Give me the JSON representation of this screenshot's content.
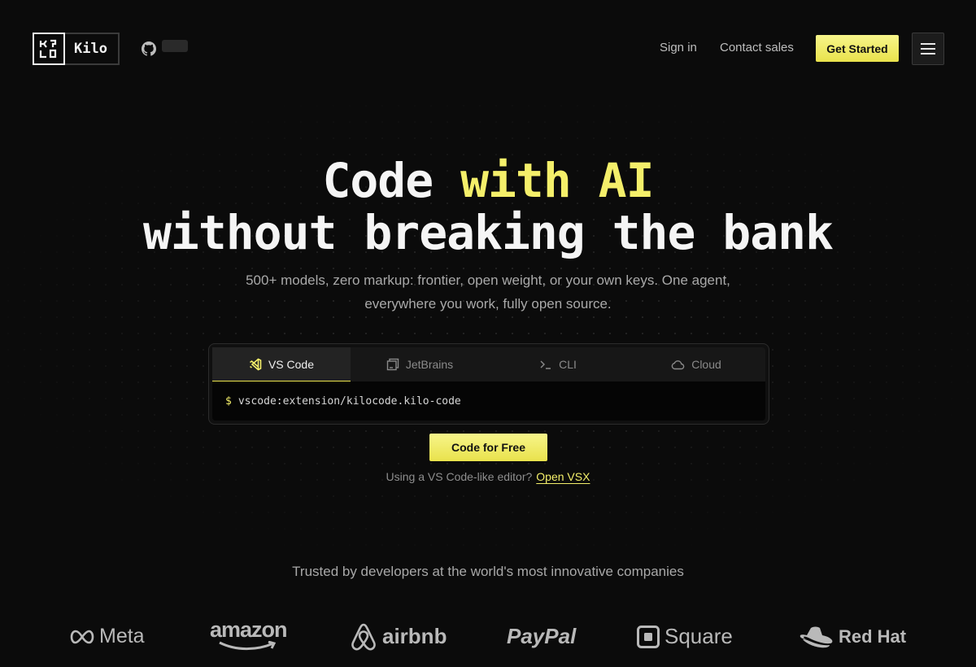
{
  "header": {
    "logo_text": "Kilo",
    "nav": {
      "sign_in": "Sign in",
      "contact_sales": "Contact sales",
      "get_started": "Get Started"
    }
  },
  "hero": {
    "title_line1_a": "Code ",
    "title_line1_b": "with AI",
    "title_line2": "without breaking the bank",
    "subtitle": "500+ models, zero markup: frontier, open weight, or your own keys. One agent, everywhere you work, fully open source."
  },
  "install": {
    "tabs": [
      {
        "label": "VS Code",
        "icon": "vscode-icon"
      },
      {
        "label": "JetBrains",
        "icon": "jetbrains-icon"
      },
      {
        "label": "CLI",
        "icon": "terminal-icon"
      },
      {
        "label": "Cloud",
        "icon": "cloud-icon"
      }
    ],
    "prompt": "$",
    "command": "vscode:extension/kilocode.kilo-code"
  },
  "cta": {
    "button": "Code for Free",
    "vsx_text": "Using a VS Code-like editor?",
    "vsx_link": "Open VSX"
  },
  "trusted": {
    "heading": "Trusted by developers at the world's most innovative companies",
    "companies": [
      "Meta",
      "amazon",
      "airbnb",
      "PayPal",
      "Square",
      "Red Hat"
    ]
  },
  "colors": {
    "accent": "#f4ef6a",
    "background": "#0b0b0b"
  }
}
